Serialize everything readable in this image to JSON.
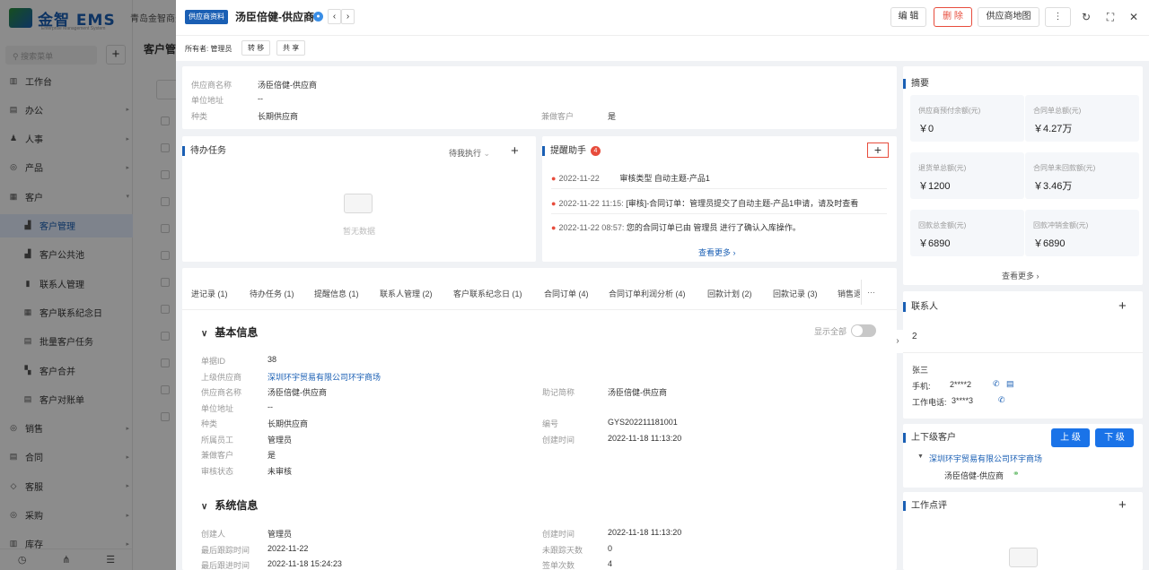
{
  "app": {
    "logo_text": "金智 EMS",
    "logo_sub": "Enterprise Management System",
    "company": "青岛金智商务",
    "search_placeholder": "搜索菜单",
    "add": "+",
    "menu": [
      {
        "icon": "▥",
        "label": "工作台",
        "arrow": ""
      },
      {
        "icon": "▤",
        "label": "办公",
        "arrow": "▸"
      },
      {
        "icon": "♟",
        "label": "人事",
        "arrow": "▸"
      },
      {
        "icon": "◎",
        "label": "产品",
        "arrow": "▸"
      },
      {
        "icon": "▦",
        "label": "客户",
        "arrow": "▾"
      },
      {
        "icon": "▟",
        "label": "客户管理",
        "arrow": ""
      },
      {
        "icon": "▟",
        "label": "客户公共池",
        "arrow": ""
      },
      {
        "icon": "▮",
        "label": "联系人管理",
        "arrow": ""
      },
      {
        "icon": "▦",
        "label": "客户联系纪念日",
        "arrow": ""
      },
      {
        "icon": "▤",
        "label": "批量客户任务",
        "arrow": ""
      },
      {
        "icon": "▚",
        "label": "客户合并",
        "arrow": ""
      },
      {
        "icon": "▤",
        "label": "客户对账单",
        "arrow": ""
      },
      {
        "icon": "◎",
        "label": "销售",
        "arrow": "▸"
      },
      {
        "icon": "▤",
        "label": "合同",
        "arrow": "▸"
      },
      {
        "icon": "◇",
        "label": "客服",
        "arrow": "▸"
      },
      {
        "icon": "◎",
        "label": "采购",
        "arrow": "▸"
      },
      {
        "icon": "▥",
        "label": "库存",
        "arrow": "▸"
      }
    ],
    "foot_icons": [
      "◷",
      "⋔",
      "☰"
    ],
    "bg_tab": "客户管"
  },
  "drawer": {
    "type_tag": "供应商资料",
    "title": "汤臣倍健-供应商",
    "title_badge": "●",
    "prev": "‹",
    "next": "›",
    "buttons": {
      "edit": "编 辑",
      "delete": "删 除",
      "map": "供应商地图",
      "more": "⋮"
    },
    "icons": {
      "refresh": "↻",
      "fullscreen": "⛶",
      "close": "✕"
    },
    "owner_label": "所有者: 管理员",
    "transfer": "转 移",
    "share": "共 享"
  },
  "overview": {
    "rows": [
      {
        "label": "供应商名称",
        "value": "汤臣倍健-供应商"
      },
      {
        "label": "单位地址",
        "value": "--"
      },
      {
        "label": "种类",
        "value": "长期供应商"
      }
    ],
    "extra_label": "兼做客户",
    "extra_value": "是"
  },
  "todo": {
    "title": "待办任务",
    "filter": "待我执行",
    "empty": "暂无数据"
  },
  "reminder": {
    "title": "提醒助手",
    "count": "4",
    "items": [
      {
        "date": "2022-11-22",
        "text": "审核类型 自动主题-产品1"
      },
      {
        "date": "2022-11-22 11:15:",
        "text": "[审核]-合同订单：管理员提交了自动主题-产品1申请，请及时查看"
      },
      {
        "date": "2022-11-22 08:57:",
        "text": "您的合同订单已由 管理员 进行了确认入库操作。"
      }
    ],
    "more": "查看更多 ›"
  },
  "tabs": [
    "进记录 (1)",
    "待办任务 (1)",
    "提醒信息 (1)",
    "联系人管理 (2)",
    "客户联系纪念日 (1)",
    "合同订单 (4)",
    "合同订单利润分析 (4)",
    "回款计划 (2)",
    "回款记录 (3)",
    "销售退"
  ],
  "tabs_more": "···",
  "basic": {
    "title": "基本信息",
    "show_all": "显示全部",
    "left": [
      {
        "label": "单据ID",
        "value": "38"
      },
      {
        "label": "上级供应商",
        "value": "深圳环宇贸易有限公司环宇商场"
      },
      {
        "label": "供应商名称",
        "value": "汤臣倍健-供应商"
      },
      {
        "label": "单位地址",
        "value": "--"
      },
      {
        "label": "种类",
        "value": "长期供应商"
      },
      {
        "label": "所属员工",
        "value": "管理员"
      },
      {
        "label": "兼做客户",
        "value": "是"
      },
      {
        "label": "审核状态",
        "value": "未审核"
      }
    ],
    "right": [
      {
        "label": "助记简称",
        "value": "汤臣倍健-供应商"
      },
      {
        "label": "编号",
        "value": "GYS202211181001"
      },
      {
        "label": "创建时间",
        "value": "2022-11-18 11:13:20"
      }
    ]
  },
  "system": {
    "title": "系统信息",
    "left": [
      {
        "label": "创建人",
        "value": "管理员"
      },
      {
        "label": "最后跟踪时间",
        "value": "2022-11-22"
      },
      {
        "label": "最后跟进时间",
        "value": "2022-11-18 15:24:23"
      }
    ],
    "right": [
      {
        "label": "创建时间",
        "value": "2022-11-18 11:13:20"
      },
      {
        "label": "未跟踪天数",
        "value": "0"
      },
      {
        "label": "签单次数",
        "value": "4"
      }
    ]
  },
  "summary": {
    "title": "摘要",
    "items": [
      {
        "label": "供应商预付余额(元)",
        "value": "￥0"
      },
      {
        "label": "合同单总额(元)",
        "value": "￥4.27万"
      },
      {
        "label": "退货单总额(元)",
        "value": "￥1200"
      },
      {
        "label": "合同单未回款额(元)",
        "value": "￥3.46万"
      },
      {
        "label": "回款总金额(元)",
        "value": "￥6890"
      },
      {
        "label": "回款冲销金额(元)",
        "value": "￥6890"
      }
    ],
    "more": "查看更多 ›"
  },
  "contacts": {
    "title": "联系人",
    "count": "2",
    "name": "张三",
    "phone_label": "手机:",
    "phone": "2****2",
    "tel_label": "工作电话:",
    "tel": "3****3"
  },
  "hierarchy": {
    "title": "上下级客户",
    "up": "上 级",
    "down": "下 级",
    "parent": "深圳环宇贸易有限公司环宇商场",
    "child": "汤臣倍健-供应商"
  },
  "review": {
    "title": "工作点评"
  },
  "colors": {
    "accent": "#1a5fb4",
    "danger": "#e74c3c",
    "primary_btn": "#1a73e8"
  }
}
